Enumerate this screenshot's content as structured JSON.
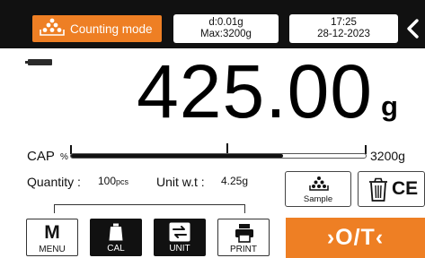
{
  "header": {
    "mode_label": "Counting mode",
    "division": "d:0.01g",
    "max_capacity": "Max:3200g",
    "time": "17:25",
    "date": "28-12-2023"
  },
  "display": {
    "weight": "425.00",
    "unit": "g"
  },
  "capacity": {
    "label": "CAP",
    "percent_symbol": "%",
    "max_label": "3200g",
    "fill_fraction": 0.72
  },
  "counting": {
    "quantity_label": "Quantity :",
    "quantity_value": "100",
    "quantity_unit": "pcs",
    "unit_weight_label": "Unit w.t :",
    "unit_weight_value": "4.25g"
  },
  "buttons": {
    "sample": "Sample",
    "clear_entry": "CE",
    "menu_letter": "M",
    "menu": "MENU",
    "cal": "CAL",
    "unit": "UNIT",
    "print": "PRINT",
    "tare": "›O/T‹"
  },
  "colors": {
    "accent": "#ee7f24",
    "header_bg": "#111111"
  },
  "icons": [
    "weights-icon",
    "back-chevron-icon",
    "battery-icon",
    "trash-icon",
    "calibration-weight-icon",
    "unit-convert-icon",
    "printer-icon"
  ]
}
